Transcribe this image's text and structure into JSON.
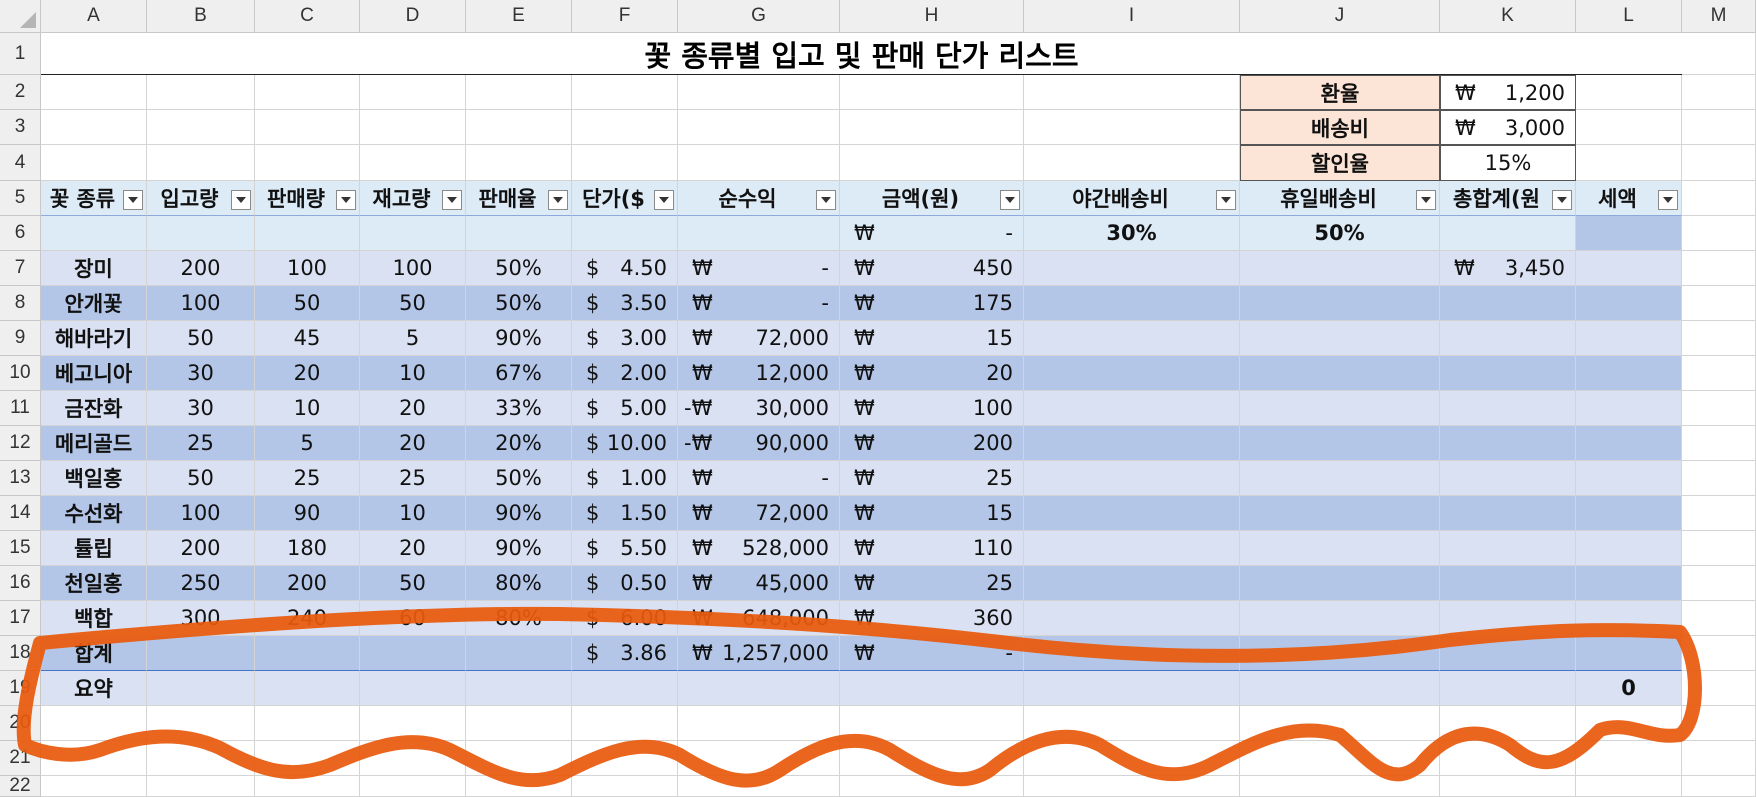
{
  "columns": [
    "A",
    "B",
    "C",
    "D",
    "E",
    "F",
    "G",
    "H",
    "I",
    "J",
    "K",
    "L",
    "M"
  ],
  "rows": [
    "1",
    "2",
    "3",
    "4",
    "5",
    "6",
    "7",
    "8",
    "9",
    "10",
    "11",
    "12",
    "13",
    "14",
    "15",
    "16",
    "17",
    "18",
    "19",
    "20",
    "21",
    "22"
  ],
  "title": "꽃 종류별 입고 및 판매 단가 리스트",
  "settings": [
    {
      "label": "환율",
      "currency": "₩",
      "value": "1,200"
    },
    {
      "label": "배송비",
      "currency": "₩",
      "value": "3,000"
    },
    {
      "label": "할인율",
      "currency": "",
      "value": "15%"
    }
  ],
  "headers": [
    "꽃 종류",
    "입고량",
    "판매량",
    "재고량",
    "판매율",
    "단가($",
    "순수익",
    "금액(원)",
    "야간배송비",
    "휴일배송비",
    "총합계(원",
    "세액"
  ],
  "row6": {
    "h_currency": "₩",
    "h_value": "-",
    "i_value": "30%",
    "j_value": "50%"
  },
  "data_rows": [
    {
      "name": "장미",
      "in": "200",
      "sold": "100",
      "stock": "100",
      "rate": "50%",
      "usd": "4.50",
      "profit_sign": "",
      "profit": "-",
      "amount": "450",
      "total": "3,450"
    },
    {
      "name": "안개꽃",
      "in": "100",
      "sold": "50",
      "stock": "50",
      "rate": "50%",
      "usd": "3.50",
      "profit_sign": "",
      "profit": "-",
      "amount": "175",
      "total": ""
    },
    {
      "name": "해바라기",
      "in": "50",
      "sold": "45",
      "stock": "5",
      "rate": "90%",
      "usd": "3.00",
      "profit_sign": "",
      "profit": "72,000",
      "amount": "15",
      "total": ""
    },
    {
      "name": "베고니아",
      "in": "30",
      "sold": "20",
      "stock": "10",
      "rate": "67%",
      "usd": "2.00",
      "profit_sign": "",
      "profit": "12,000",
      "amount": "20",
      "total": ""
    },
    {
      "name": "금잔화",
      "in": "30",
      "sold": "10",
      "stock": "20",
      "rate": "33%",
      "usd": "5.00",
      "profit_sign": "-",
      "profit": "30,000",
      "amount": "100",
      "total": ""
    },
    {
      "name": "메리골드",
      "in": "25",
      "sold": "5",
      "stock": "20",
      "rate": "20%",
      "usd": "10.00",
      "profit_sign": "-",
      "profit": "90,000",
      "amount": "200",
      "total": ""
    },
    {
      "name": "백일홍",
      "in": "50",
      "sold": "25",
      "stock": "25",
      "rate": "50%",
      "usd": "1.00",
      "profit_sign": "",
      "profit": "-",
      "amount": "25",
      "total": ""
    },
    {
      "name": "수선화",
      "in": "100",
      "sold": "90",
      "stock": "10",
      "rate": "90%",
      "usd": "1.50",
      "profit_sign": "",
      "profit": "72,000",
      "amount": "15",
      "total": ""
    },
    {
      "name": "튤립",
      "in": "200",
      "sold": "180",
      "stock": "20",
      "rate": "90%",
      "usd": "5.50",
      "profit_sign": "",
      "profit": "528,000",
      "amount": "110",
      "total": ""
    },
    {
      "name": "천일홍",
      "in": "250",
      "sold": "200",
      "stock": "50",
      "rate": "80%",
      "usd": "0.50",
      "profit_sign": "",
      "profit": "45,000",
      "amount": "25",
      "total": ""
    },
    {
      "name": "백합",
      "in": "300",
      "sold": "240",
      "stock": "60",
      "rate": "80%",
      "usd": "6.00",
      "profit_sign": "",
      "profit": "648,000",
      "amount": "360",
      "total": ""
    }
  ],
  "totals": {
    "label": "합계",
    "usd": "3.86",
    "profit": "1,257,000",
    "amount": "-"
  },
  "summary": {
    "label": "요약",
    "value": "0"
  },
  "symbols": {
    "dollar": "$",
    "won": "₩"
  },
  "colors": {
    "band_light": "#d9e1f2",
    "band_dark": "#b4c6e7",
    "header_fill": "#ddebf7",
    "setting_fill": "#fce4d6",
    "annotation": "#e8590c"
  }
}
